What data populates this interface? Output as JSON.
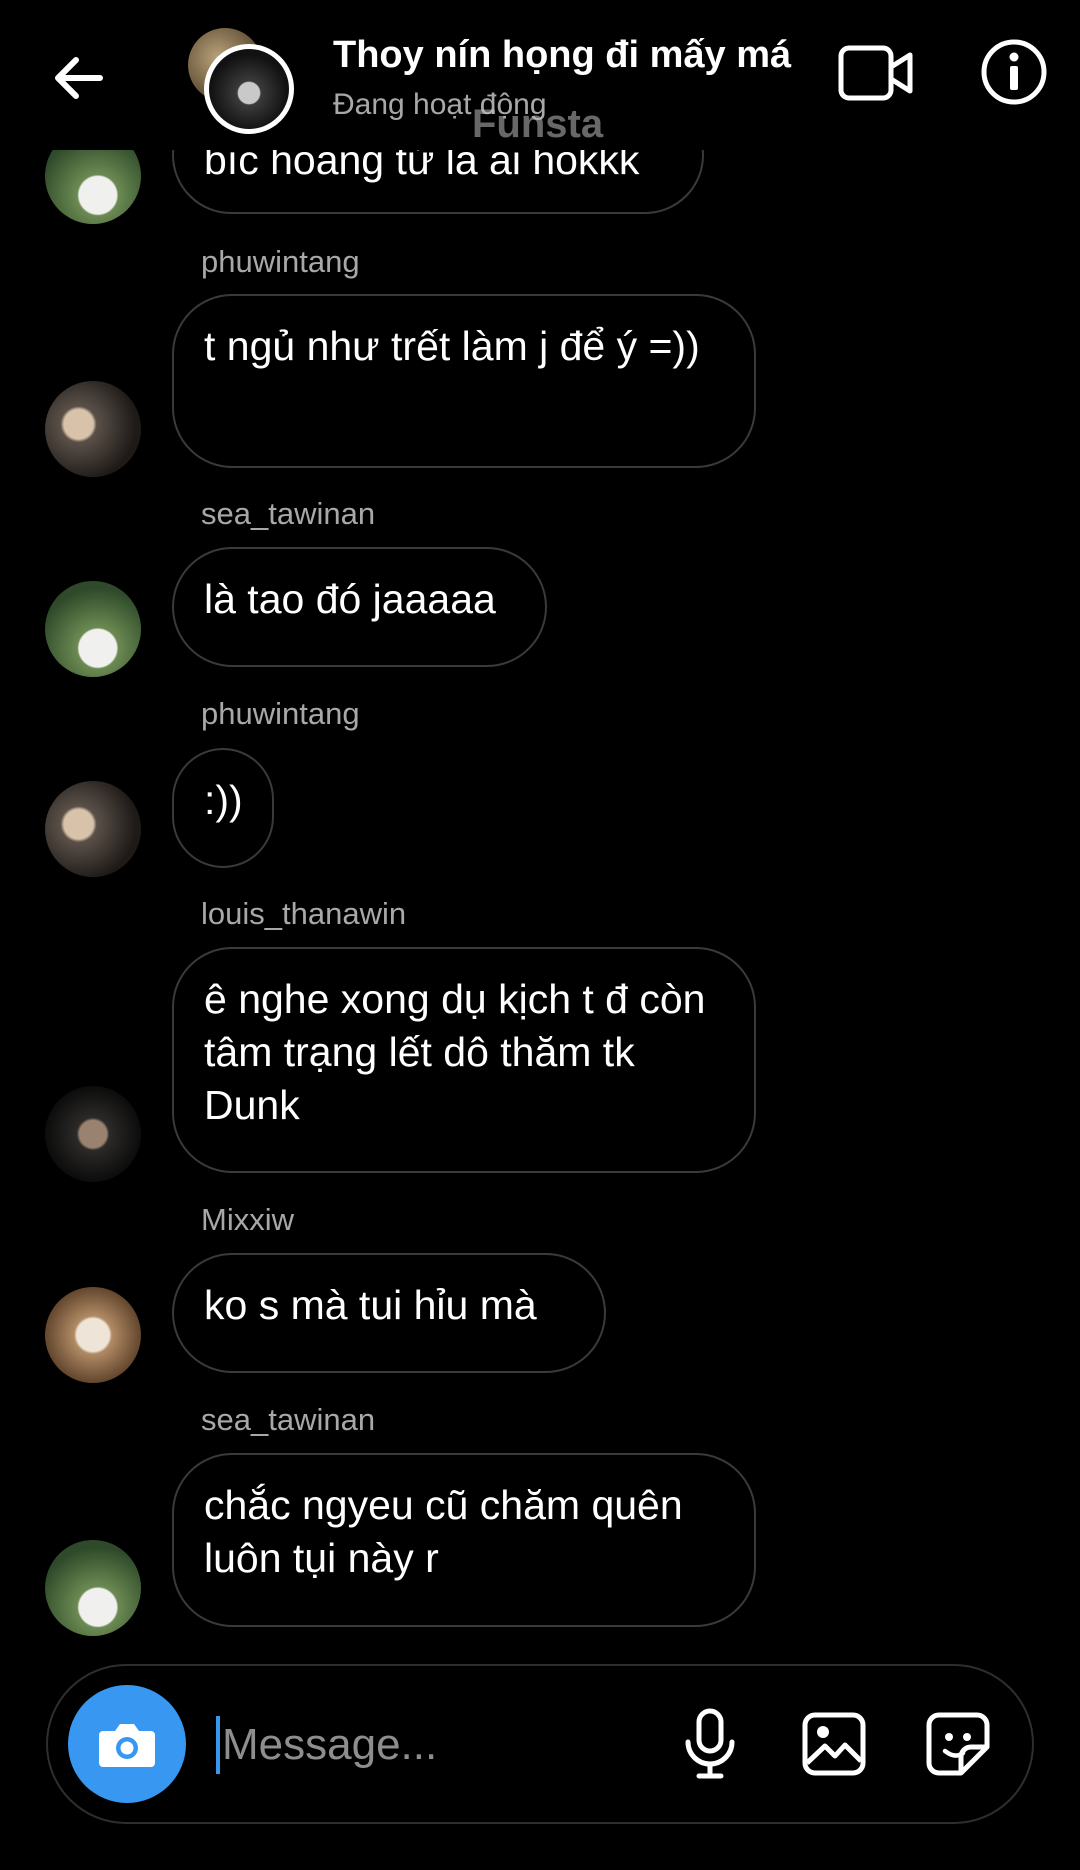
{
  "header": {
    "title": "Thoy nín họng đi mấy má",
    "status": "Đang hoạt động",
    "watermark": "Funsta",
    "icons": {
      "back": "back-arrow-icon",
      "video": "video-call-icon",
      "info": "info-icon"
    }
  },
  "messages": [
    {
      "sender": "",
      "text": "bíc hoàng tử là ai hokkk",
      "avatar": "sea_tawinan"
    },
    {
      "sender": "phuwintang",
      "text": "t ngủ như trết làm j để ý =))",
      "avatar": "phuwintang"
    },
    {
      "sender": "sea_tawinan",
      "text": "là tao đó jaaaaa",
      "avatar": "sea_tawinan"
    },
    {
      "sender": "phuwintang",
      "text": ":))",
      "avatar": "phuwintang"
    },
    {
      "sender": "louis_thanawin",
      "text": "ê nghe xong dụ kịch t đ còn tâm trạng lết dô thăm tk Dunk",
      "avatar": "louis_thanawin"
    },
    {
      "sender": "Mixxiw",
      "text": "ko s mà tui hỉu mà",
      "avatar": "Mixxiw"
    },
    {
      "sender": "sea_tawinan",
      "text": "chắc ngyeu cũ chăm quên luôn tụi này r",
      "avatar": "sea_tawinan"
    }
  ],
  "composer": {
    "placeholder": "Message...",
    "value": "",
    "icons": {
      "camera": "camera-icon",
      "mic": "microphone-icon",
      "gallery": "gallery-icon",
      "sticker": "sticker-icon"
    }
  },
  "colors": {
    "background": "#000000",
    "accent": "#3897f0",
    "bubble_border": "#3a3a3a",
    "secondary_text": "#a8a8a8"
  }
}
